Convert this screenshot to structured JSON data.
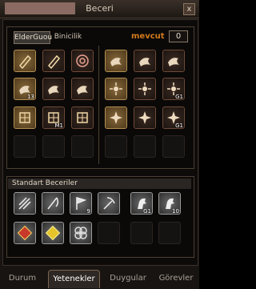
{
  "window": {
    "title": "Beceri",
    "close_label": "x"
  },
  "subtabs": [
    "ElderGuou",
    "Binicilik"
  ],
  "header": {
    "mevcut_label": "mevcut",
    "points_value": "0"
  },
  "skill_rows": [
    [
      {
        "type": "gold",
        "icon": "scroll-icon"
      },
      {
        "type": "dark",
        "icon": "scroll-icon"
      },
      {
        "type": "dark",
        "icon": "spiral-icon"
      },
      {
        "type": "gold",
        "icon": "dragon-icon"
      },
      {
        "type": "dark",
        "icon": "dragon-icon"
      },
      {
        "type": "dark",
        "icon": "dragon-icon"
      }
    ],
    [
      {
        "type": "gold",
        "icon": "dragon-icon",
        "level": "13"
      },
      {
        "type": "dark",
        "icon": "dragon-icon"
      },
      {
        "type": "dark",
        "icon": "dragon-icon"
      },
      {
        "type": "gold",
        "icon": "whirl-icon"
      },
      {
        "type": "dark",
        "icon": "whirl-icon"
      },
      {
        "type": "dark",
        "icon": "whirl-icon",
        "level": "G1"
      }
    ],
    [
      {
        "type": "gold",
        "icon": "grid-icon"
      },
      {
        "type": "dark",
        "icon": "grid-icon",
        "level": "M1"
      },
      {
        "type": "dark",
        "icon": "grid-icon"
      },
      {
        "type": "gold",
        "icon": "star-icon"
      },
      {
        "type": "dark",
        "icon": "star-icon"
      },
      {
        "type": "dark",
        "icon": "star-icon",
        "level": "G1"
      }
    ],
    [
      {
        "type": "empty"
      },
      {
        "type": "empty"
      },
      {
        "type": "empty"
      },
      {
        "type": "empty"
      },
      {
        "type": "empty"
      },
      {
        "type": "empty"
      }
    ]
  ],
  "standard": {
    "title": "Standart Beceriler",
    "row1": [
      {
        "icon": "arrows-icon"
      },
      {
        "icon": "fishing-icon"
      },
      {
        "icon": "flag-icon",
        "level": "9"
      },
      {
        "icon": "pickaxe-icon"
      },
      {
        "icon": "horse-icon",
        "level": "G1"
      },
      {
        "icon": "horse-icon",
        "level": "10"
      }
    ],
    "row2": [
      {
        "icon": "red-book-icon"
      },
      {
        "icon": "yellow-book-icon"
      },
      {
        "icon": "knot-icon"
      }
    ]
  },
  "bottom_tabs": [
    "Durum",
    "Yetenekler",
    "Duygular",
    "Görevler"
  ],
  "active_tab": 1
}
